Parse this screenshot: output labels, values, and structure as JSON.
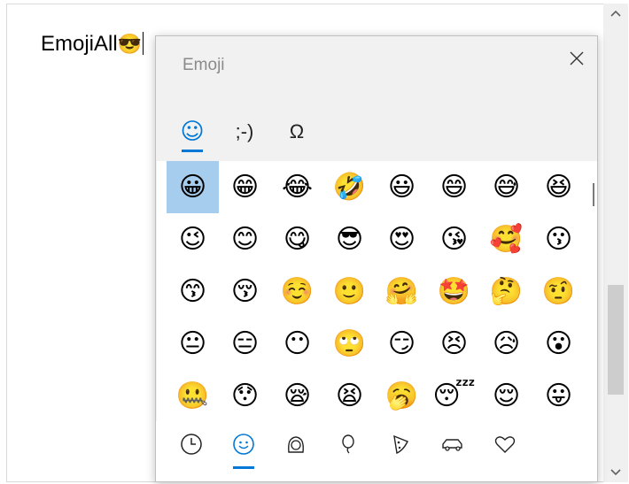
{
  "document": {
    "text": "EmojiAll",
    "inserted_emoji": "😎"
  },
  "emoji_panel": {
    "title": "Emoji",
    "close_icon": "close-icon",
    "tabs": [
      {
        "label": "☺",
        "name": "emoji",
        "active": true
      },
      {
        "label": ";-)",
        "name": "kaomoji",
        "active": false
      },
      {
        "label": "Ω",
        "name": "symbols",
        "active": false
      }
    ],
    "grid": [
      [
        "😀",
        "😁",
        "😂",
        "🤣",
        "😃",
        "😄",
        "😅",
        "😆"
      ],
      [
        "😉",
        "😊",
        "😋",
        "😎",
        "😍",
        "😘",
        "🥰",
        "😗"
      ],
      [
        "😙",
        "😚",
        "☺️",
        "🙂",
        "🤗",
        "🤩",
        "🤔",
        "🤨"
      ],
      [
        "😐",
        "😑",
        "😶",
        "🙄",
        "😏",
        "😣",
        "😥",
        "😮"
      ],
      [
        "🤐",
        "😯",
        "😪",
        "😫",
        "🥱",
        "😴",
        "😌",
        "😛"
      ]
    ],
    "selected": "😀",
    "categories": [
      {
        "name": "recent",
        "icon": "clock-icon",
        "active": false
      },
      {
        "name": "smileys",
        "icon": "smiley-icon",
        "active": true
      },
      {
        "name": "people",
        "icon": "person-icon",
        "active": false
      },
      {
        "name": "celebration",
        "icon": "balloon-icon",
        "active": false
      },
      {
        "name": "food",
        "icon": "pizza-icon",
        "active": false
      },
      {
        "name": "travel",
        "icon": "car-icon",
        "active": false
      },
      {
        "name": "symbols",
        "icon": "heart-icon",
        "active": false
      }
    ]
  },
  "colors": {
    "accent": "#0078d7",
    "selection": "#a7cdee",
    "panel_bg": "#f1f1f1"
  }
}
